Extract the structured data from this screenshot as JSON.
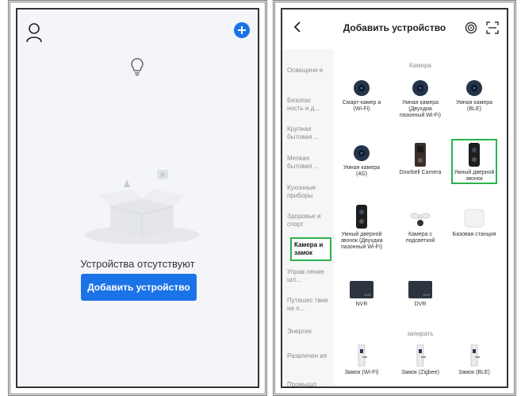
{
  "left_screen": {
    "empty_text": "Устройства отсутствуют",
    "add_button_label": "Добавить устройство",
    "icons": [
      "user-icon",
      "add-circle-icon",
      "lightbulb-icon",
      "empty-box-illustration"
    ],
    "accent_color": "#1b73e8"
  },
  "right_screen": {
    "title": "Добавить устройство",
    "icons": [
      "back-icon",
      "wifi-scan-icon",
      "qr-scan-icon"
    ],
    "sidebar": [
      {
        "label": "Освещени е"
      },
      {
        "label": "Безопас ность и д..."
      },
      {
        "label": "Крупная бытовая ..."
      },
      {
        "label": "Мелкая бытовая ..."
      },
      {
        "label": "Кухонные приборы"
      },
      {
        "label": "Здоровье и спорт"
      },
      {
        "label": "Камера и замок"
      },
      {
        "label": "Управ ление шл..."
      },
      {
        "label": "Путешес твие на о..."
      },
      {
        "label": "Энергия"
      },
      {
        "label": "Развлечен ия"
      },
      {
        "label": "Промышл енность ..."
      }
    ],
    "active_sidebar_label": "Камера и замок",
    "sections": {
      "camera": "Камера",
      "lock": "запирать"
    },
    "devices": [
      {
        "label": "Смарт-камер а (Wi-Fi)",
        "icon": "camera-icon"
      },
      {
        "label": "Умная камера (Двухдиа пазонный Wi-Fi)",
        "icon": "camera-icon"
      },
      {
        "label": "Умная камера (BLE)",
        "icon": "camera-icon"
      },
      {
        "label": "Умная камера (4G)",
        "icon": "camera-icon"
      },
      {
        "label": "Doorbell Camera",
        "icon": "doorbell-icon"
      },
      {
        "label": "Умный дверной звонок",
        "icon": "doorbell-icon"
      },
      {
        "label": "Умный дверной звонок (Двухдиа пазонный Wi-Fi)",
        "icon": "doorbell-icon"
      },
      {
        "label": "Камера с подсветкой",
        "icon": "floodlight-camera-icon"
      },
      {
        "label": "Базовая станция",
        "icon": "base-station-icon"
      },
      {
        "label": "NVR",
        "icon": "nvr-icon",
        "badge": "NVR"
      },
      {
        "label": "DVR",
        "icon": "dvr-icon",
        "badge": "DVR"
      },
      {
        "label": "Замок (Wi-Fi)",
        "icon": "lock-icon"
      },
      {
        "label": "Замок (Zigbee)",
        "icon": "lock-icon"
      },
      {
        "label": "Замок (BLE)",
        "icon": "lock-icon"
      }
    ],
    "highlight_color": "#2bb24c"
  }
}
